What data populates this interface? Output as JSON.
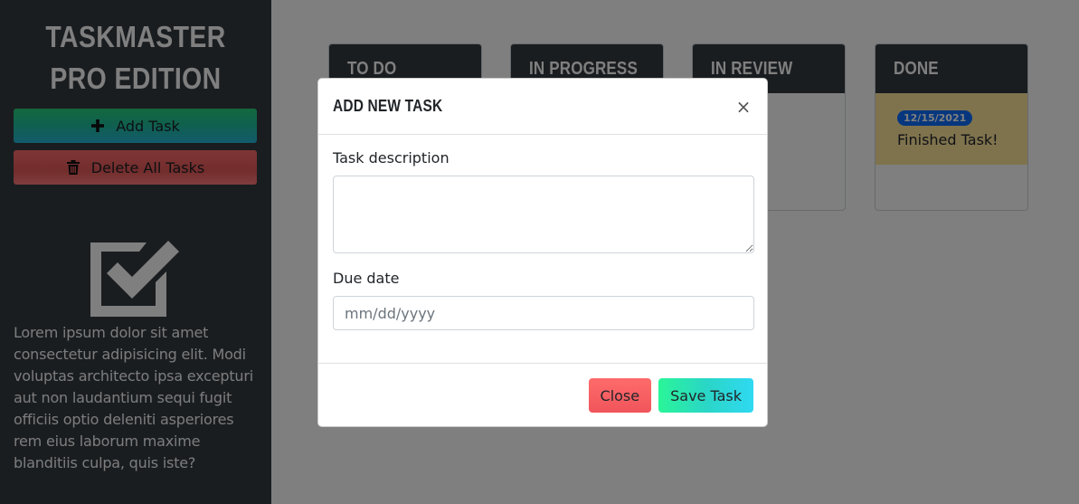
{
  "sidebar": {
    "title": "TASKMASTER PRO EDITION",
    "add_button": {
      "label": "Add Task",
      "icon": "plus-icon"
    },
    "delete_button": {
      "label": "Delete All Tasks",
      "icon": "trash-icon"
    },
    "hero_icon": "checkbox-icon",
    "description": "Lorem ipsum dolor sit amet consectetur adipisicing elit. Modi voluptas architecto ipsa excepturi aut non laudantium sequi fugit officiis optio deleniti asperiores rem eius laborum maxime blanditiis culpa, quis iste?"
  },
  "board": {
    "columns": [
      {
        "title": "TO DO",
        "tasks": []
      },
      {
        "title": "IN PROGRESS",
        "tasks": []
      },
      {
        "title": "IN REVIEW",
        "tasks": []
      },
      {
        "title": "DONE",
        "tasks": [
          {
            "date": "12/15/2021",
            "text": "Finished Task!"
          }
        ]
      }
    ]
  },
  "modal": {
    "title": "ADD NEW TASK",
    "close_icon": "close-icon",
    "description_label": "Task description",
    "description_value": "",
    "due_label": "Due date",
    "due_placeholder": "mm/dd/yyyy",
    "close_button": "Close",
    "save_button": "Save Task"
  },
  "colors": {
    "sidebar_bg": "#343a40",
    "column_header_bg": "#343a40",
    "task_card_bg": "#ffe69c",
    "badge_bg": "#0d6efd",
    "backdrop": "rgba(0,0,0,0.5)"
  }
}
